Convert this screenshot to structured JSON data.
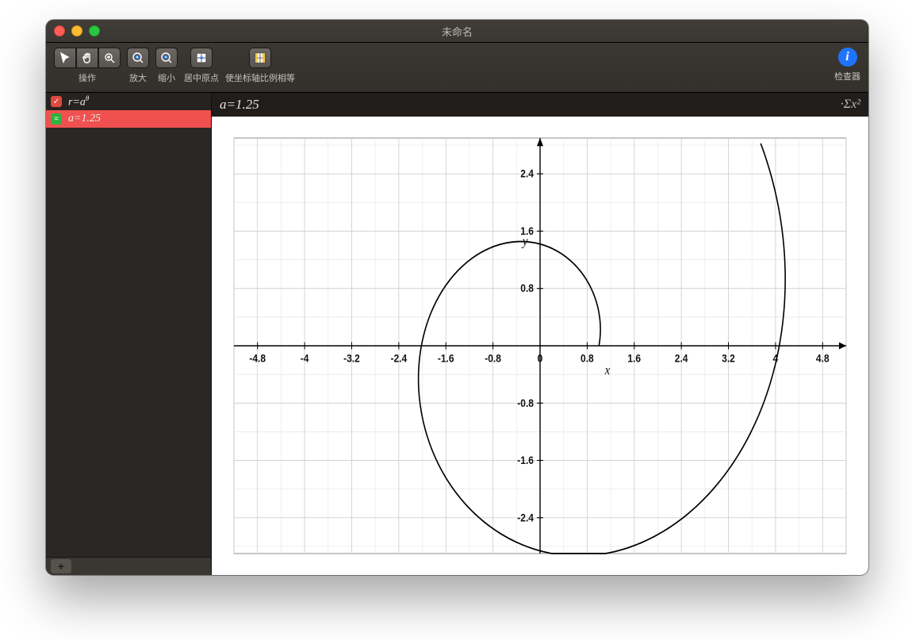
{
  "window": {
    "title": "未命名"
  },
  "toolbar": {
    "actions_label": "操作",
    "zoom_in_label": "放大",
    "zoom_out_label": "缩小",
    "center_label": "居中原点",
    "equal_axes_label": "使坐标轴比例相等",
    "inspector_label": "检查器"
  },
  "sidebar": {
    "equations": [
      {
        "checked": true,
        "check_color": "red",
        "display_html": "r=a<sup>θ</sup>"
      },
      {
        "checked": true,
        "check_color": "green",
        "display_html": "a=1.25"
      }
    ]
  },
  "valuebar": {
    "text": "a=1.25",
    "sigma_text": "·Σx²"
  },
  "chart_data": {
    "type": "line",
    "title": "",
    "xlabel": "x",
    "ylabel": "y",
    "xlim": [
      -5.2,
      5.2
    ],
    "ylim": [
      -2.9,
      2.9
    ],
    "xticks": [
      -4.8,
      -4,
      -3.2,
      -2.4,
      -1.6,
      -0.8,
      0,
      0.8,
      1.6,
      2.4,
      3.2,
      4,
      4.8
    ],
    "yticks": [
      -2.4,
      -1.6,
      -0.8,
      0,
      0.8,
      1.6,
      2.4
    ],
    "series": [
      {
        "name": "r = a^θ (a=1.25)",
        "polar_formula": "r = 1.25^θ",
        "theta_range_deg": [
          0,
          430
        ],
        "sample_points_xy": [
          [
            1.0,
            0.0
          ],
          [
            0.844,
            0.734
          ],
          [
            0.222,
            1.263
          ],
          [
            -0.603,
            1.321
          ],
          [
            -1.396,
            0.806
          ],
          [
            -1.746,
            -0.309
          ],
          [
            -1.402,
            -1.654
          ],
          [
            -0.175,
            -2.479
          ],
          [
            1.599,
            -2.318
          ],
          [
            2.981,
            -1.085
          ],
          [
            3.269,
            0.576
          ]
        ]
      }
    ]
  }
}
